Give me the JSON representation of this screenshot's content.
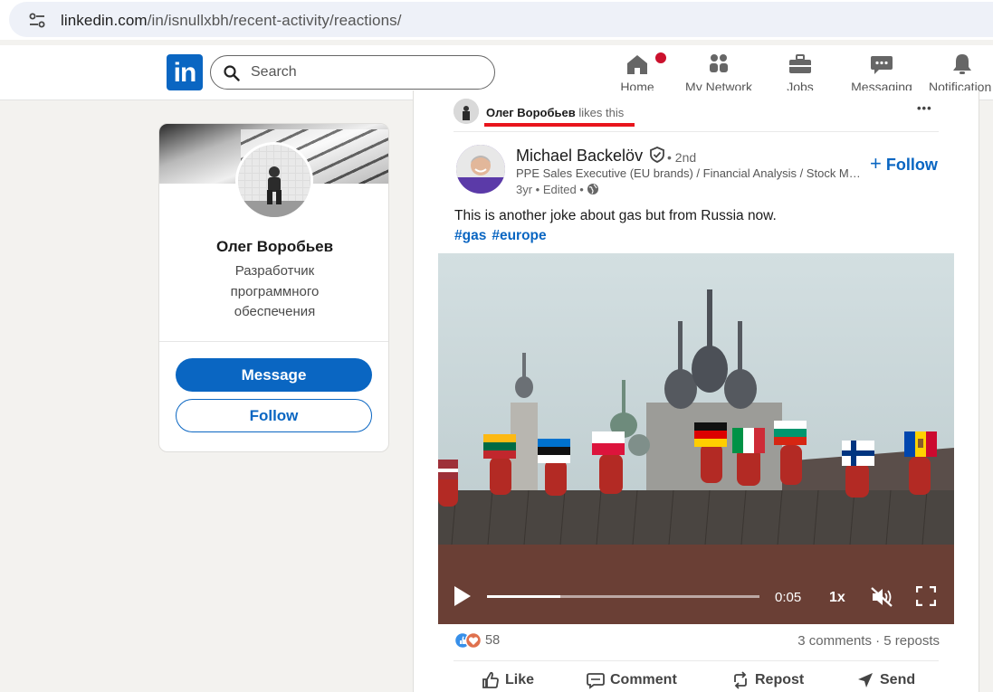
{
  "browser": {
    "url_host": "linkedin.com",
    "url_path": "/in/isnullxbh/recent-activity/reactions/"
  },
  "nav": {
    "logo": "in",
    "search_placeholder": "Search",
    "items": [
      {
        "label": "Home",
        "icon": "home-icon"
      },
      {
        "label": "My Network",
        "icon": "network-icon"
      },
      {
        "label": "Jobs",
        "icon": "briefcase-icon"
      },
      {
        "label": "Messaging",
        "icon": "chat-icon"
      },
      {
        "label": "Notification",
        "icon": "bell-icon"
      }
    ]
  },
  "profile": {
    "name": "Олег Воробьев",
    "title": "Разработчик программного обеспечения",
    "message_label": "Message",
    "follow_label": "Follow"
  },
  "post": {
    "actor_name": "Олег Воробьев",
    "actor_action": "likes this",
    "more": "•••",
    "author_name": "Michael Backelöv",
    "author_degree": "• 2nd",
    "author_desc": "PPE Sales Executive (EU brands) / Financial Analysis / Stock Market Analysis",
    "author_time": "3yr • Edited •",
    "follow_label": "Follow",
    "text": "This is another joke about gas but from Russia now.",
    "tags": [
      "#gas",
      "#europe"
    ],
    "video": {
      "time": "0:05",
      "speed": "1x",
      "progress": 0.27
    },
    "reactions_count": "58",
    "comments_reposts": "3 comments · 5 reposts",
    "actions": [
      "Like",
      "Comment",
      "Repost",
      "Send"
    ]
  },
  "colors": {
    "linkedin_blue": "#0a66c2",
    "highlight_red": "#e8141c"
  }
}
